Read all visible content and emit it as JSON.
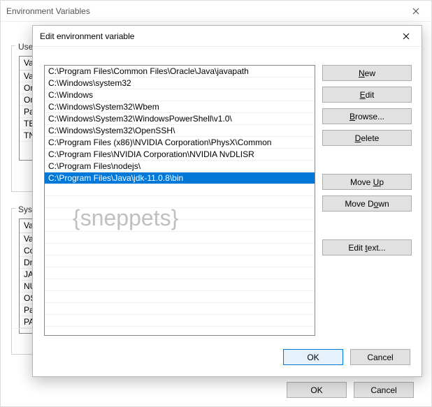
{
  "backWindow": {
    "title": "Environment Variables",
    "userGroupLabel": "User",
    "sysGroupLabel": "Syste",
    "columns": {
      "variable": "Va",
      "value": ""
    },
    "userVars": [
      "Va",
      "On",
      "On",
      "Pa",
      "TE",
      "TN"
    ],
    "sysVars": [
      "Va",
      "Co",
      "Dr",
      "JA",
      "NU",
      "OS",
      "Pa",
      "PA"
    ],
    "okLabel": "OK",
    "cancelLabel": "Cancel"
  },
  "frontWindow": {
    "title": "Edit environment variable",
    "pathEntries": [
      "C:\\Program Files\\Common Files\\Oracle\\Java\\javapath",
      "C:\\Windows\\system32",
      "C:\\Windows",
      "C:\\Windows\\System32\\Wbem",
      "C:\\Windows\\System32\\WindowsPowerShell\\v1.0\\",
      "C:\\Windows\\System32\\OpenSSH\\",
      "C:\\Program Files (x86)\\NVIDIA Corporation\\PhysX\\Common",
      "C:\\Program Files\\NVIDIA Corporation\\NVIDIA NvDLISR",
      "C:\\Program Files\\nodejs\\",
      "C:\\Program Files\\Java\\jdk-11.0.8\\bin"
    ],
    "selectedIndex": 9,
    "buttons": {
      "new": "New",
      "edit": "Edit",
      "browse": "Browse...",
      "delete": "Delete",
      "moveUp": "Move Up",
      "moveDown": "Move Down",
      "editText": "Edit text...",
      "ok": "OK",
      "cancel": "Cancel"
    },
    "watermark": "{sneppets}"
  }
}
